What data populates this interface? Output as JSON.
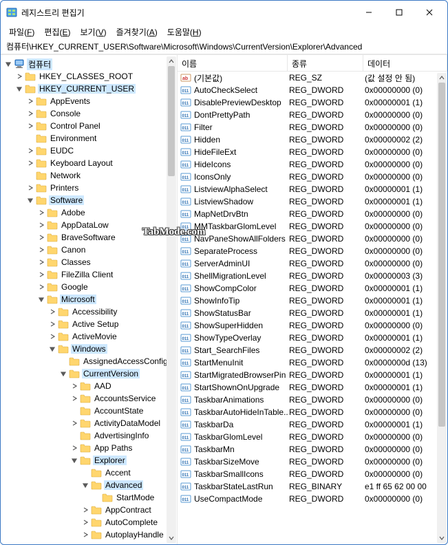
{
  "title": "레지스트리 편집기",
  "menu": {
    "file": "파일(F)",
    "edit": "편집(E)",
    "view": "보기(V)",
    "favorites": "즐겨찾기(A)",
    "help": "도움말(H)"
  },
  "address": "컴퓨터\\HKEY_CURRENT_USER\\Software\\Microsoft\\Windows\\CurrentVersion\\Explorer\\Advanced",
  "columns": {
    "name": "이름",
    "type": "종류",
    "data": "데이터"
  },
  "watermark": "TabMode.com",
  "tree": [
    {
      "depth": 0,
      "exp": "open",
      "icon": "pc",
      "label": "컴퓨터",
      "sel": true
    },
    {
      "depth": 1,
      "exp": "closed",
      "icon": "folder",
      "label": "HKEY_CLASSES_ROOT"
    },
    {
      "depth": 1,
      "exp": "open",
      "icon": "folder",
      "label": "HKEY_CURRENT_USER",
      "sel": true
    },
    {
      "depth": 2,
      "exp": "closed",
      "icon": "folder",
      "label": "AppEvents"
    },
    {
      "depth": 2,
      "exp": "closed",
      "icon": "folder",
      "label": "Console"
    },
    {
      "depth": 2,
      "exp": "closed",
      "icon": "folder",
      "label": "Control Panel"
    },
    {
      "depth": 2,
      "exp": "none",
      "icon": "folder",
      "label": "Environment"
    },
    {
      "depth": 2,
      "exp": "closed",
      "icon": "folder",
      "label": "EUDC"
    },
    {
      "depth": 2,
      "exp": "closed",
      "icon": "folder",
      "label": "Keyboard Layout"
    },
    {
      "depth": 2,
      "exp": "none",
      "icon": "folder",
      "label": "Network"
    },
    {
      "depth": 2,
      "exp": "closed",
      "icon": "folder",
      "label": "Printers"
    },
    {
      "depth": 2,
      "exp": "open",
      "icon": "folder",
      "label": "Software",
      "sel": true
    },
    {
      "depth": 3,
      "exp": "closed",
      "icon": "folder",
      "label": "Adobe"
    },
    {
      "depth": 3,
      "exp": "closed",
      "icon": "folder",
      "label": "AppDataLow"
    },
    {
      "depth": 3,
      "exp": "closed",
      "icon": "folder",
      "label": "BraveSoftware"
    },
    {
      "depth": 3,
      "exp": "closed",
      "icon": "folder",
      "label": "Canon"
    },
    {
      "depth": 3,
      "exp": "closed",
      "icon": "folder",
      "label": "Classes"
    },
    {
      "depth": 3,
      "exp": "closed",
      "icon": "folder",
      "label": "FileZilla Client"
    },
    {
      "depth": 3,
      "exp": "closed",
      "icon": "folder",
      "label": "Google"
    },
    {
      "depth": 3,
      "exp": "open",
      "icon": "folder",
      "label": "Microsoft",
      "sel": true
    },
    {
      "depth": 4,
      "exp": "closed",
      "icon": "folder",
      "label": "Accessibility"
    },
    {
      "depth": 4,
      "exp": "closed",
      "icon": "folder",
      "label": "Active Setup"
    },
    {
      "depth": 4,
      "exp": "closed",
      "icon": "folder",
      "label": "ActiveMovie"
    },
    {
      "depth": 4,
      "exp": "open",
      "icon": "folder",
      "label": "Windows",
      "sel": true
    },
    {
      "depth": 5,
      "exp": "none",
      "icon": "folder",
      "label": "AssignedAccessConfig"
    },
    {
      "depth": 5,
      "exp": "open",
      "icon": "folder",
      "label": "CurrentVersion",
      "sel": true
    },
    {
      "depth": 6,
      "exp": "closed",
      "icon": "folder",
      "label": "AAD"
    },
    {
      "depth": 6,
      "exp": "closed",
      "icon": "folder",
      "label": "AccountsService"
    },
    {
      "depth": 6,
      "exp": "none",
      "icon": "folder",
      "label": "AccountState"
    },
    {
      "depth": 6,
      "exp": "closed",
      "icon": "folder",
      "label": "ActivityDataModel"
    },
    {
      "depth": 6,
      "exp": "none",
      "icon": "folder",
      "label": "AdvertisingInfo"
    },
    {
      "depth": 6,
      "exp": "closed",
      "icon": "folder",
      "label": "App Paths"
    },
    {
      "depth": 6,
      "exp": "open",
      "icon": "folder",
      "label": "Explorer",
      "sel": true
    },
    {
      "depth": 7,
      "exp": "none",
      "icon": "folder",
      "label": "Accent"
    },
    {
      "depth": 7,
      "exp": "open",
      "icon": "folder",
      "label": "Advanced",
      "sel": true
    },
    {
      "depth": 8,
      "exp": "none",
      "icon": "folder",
      "label": "StartMode"
    },
    {
      "depth": 7,
      "exp": "closed",
      "icon": "folder",
      "label": "AppContract"
    },
    {
      "depth": 7,
      "exp": "closed",
      "icon": "folder",
      "label": "AutoComplete"
    },
    {
      "depth": 7,
      "exp": "closed",
      "icon": "folder",
      "label": "AutoplayHandle"
    }
  ],
  "values": [
    {
      "icon": "sz",
      "name": "(기본값)",
      "type": "REG_SZ",
      "data": "(값 설정 안 됨)"
    },
    {
      "icon": "dw",
      "name": "AutoCheckSelect",
      "type": "REG_DWORD",
      "data": "0x00000000 (0)"
    },
    {
      "icon": "dw",
      "name": "DisablePreviewDesktop",
      "type": "REG_DWORD",
      "data": "0x00000001 (1)"
    },
    {
      "icon": "dw",
      "name": "DontPrettyPath",
      "type": "REG_DWORD",
      "data": "0x00000000 (0)"
    },
    {
      "icon": "dw",
      "name": "Filter",
      "type": "REG_DWORD",
      "data": "0x00000000 (0)"
    },
    {
      "icon": "dw",
      "name": "Hidden",
      "type": "REG_DWORD",
      "data": "0x00000002 (2)"
    },
    {
      "icon": "dw",
      "name": "HideFileExt",
      "type": "REG_DWORD",
      "data": "0x00000000 (0)"
    },
    {
      "icon": "dw",
      "name": "HideIcons",
      "type": "REG_DWORD",
      "data": "0x00000000 (0)"
    },
    {
      "icon": "dw",
      "name": "IconsOnly",
      "type": "REG_DWORD",
      "data": "0x00000000 (0)"
    },
    {
      "icon": "dw",
      "name": "ListviewAlphaSelect",
      "type": "REG_DWORD",
      "data": "0x00000001 (1)"
    },
    {
      "icon": "dw",
      "name": "ListviewShadow",
      "type": "REG_DWORD",
      "data": "0x00000001 (1)"
    },
    {
      "icon": "dw",
      "name": "MapNetDrvBtn",
      "type": "REG_DWORD",
      "data": "0x00000000 (0)"
    },
    {
      "icon": "dw",
      "name": "MMTaskbarGlomLevel",
      "type": "REG_DWORD",
      "data": "0x00000000 (0)"
    },
    {
      "icon": "dw",
      "name": "NavPaneShowAllFolders",
      "type": "REG_DWORD",
      "data": "0x00000000 (0)"
    },
    {
      "icon": "dw",
      "name": "SeparateProcess",
      "type": "REG_DWORD",
      "data": "0x00000000 (0)"
    },
    {
      "icon": "dw",
      "name": "ServerAdminUI",
      "type": "REG_DWORD",
      "data": "0x00000000 (0)"
    },
    {
      "icon": "dw",
      "name": "ShellMigrationLevel",
      "type": "REG_DWORD",
      "data": "0x00000003 (3)"
    },
    {
      "icon": "dw",
      "name": "ShowCompColor",
      "type": "REG_DWORD",
      "data": "0x00000001 (1)"
    },
    {
      "icon": "dw",
      "name": "ShowInfoTip",
      "type": "REG_DWORD",
      "data": "0x00000001 (1)"
    },
    {
      "icon": "dw",
      "name": "ShowStatusBar",
      "type": "REG_DWORD",
      "data": "0x00000001 (1)"
    },
    {
      "icon": "dw",
      "name": "ShowSuperHidden",
      "type": "REG_DWORD",
      "data": "0x00000000 (0)"
    },
    {
      "icon": "dw",
      "name": "ShowTypeOverlay",
      "type": "REG_DWORD",
      "data": "0x00000001 (1)"
    },
    {
      "icon": "dw",
      "name": "Start_SearchFiles",
      "type": "REG_DWORD",
      "data": "0x00000002 (2)"
    },
    {
      "icon": "dw",
      "name": "StartMenuInit",
      "type": "REG_DWORD",
      "data": "0x0000000d (13)"
    },
    {
      "icon": "dw",
      "name": "StartMigratedBrowserPin",
      "type": "REG_DWORD",
      "data": "0x00000001 (1)"
    },
    {
      "icon": "dw",
      "name": "StartShownOnUpgrade",
      "type": "REG_DWORD",
      "data": "0x00000001 (1)"
    },
    {
      "icon": "dw",
      "name": "TaskbarAnimations",
      "type": "REG_DWORD",
      "data": "0x00000000 (0)"
    },
    {
      "icon": "dw",
      "name": "TaskbarAutoHideInTable...",
      "type": "REG_DWORD",
      "data": "0x00000000 (0)"
    },
    {
      "icon": "dw",
      "name": "TaskbarDa",
      "type": "REG_DWORD",
      "data": "0x00000001 (1)"
    },
    {
      "icon": "dw",
      "name": "TaskbarGlomLevel",
      "type": "REG_DWORD",
      "data": "0x00000000 (0)"
    },
    {
      "icon": "dw",
      "name": "TaskbarMn",
      "type": "REG_DWORD",
      "data": "0x00000000 (0)"
    },
    {
      "icon": "dw",
      "name": "TaskbarSizeMove",
      "type": "REG_DWORD",
      "data": "0x00000000 (0)"
    },
    {
      "icon": "dw",
      "name": "TaskbarSmallIcons",
      "type": "REG_DWORD",
      "data": "0x00000000 (0)"
    },
    {
      "icon": "dw",
      "name": "TaskbarStateLastRun",
      "type": "REG_BINARY",
      "data": "e1 ff 65 62 00 00"
    },
    {
      "icon": "dw",
      "name": "UseCompactMode",
      "type": "REG_DWORD",
      "data": "0x00000000 (0)"
    }
  ]
}
